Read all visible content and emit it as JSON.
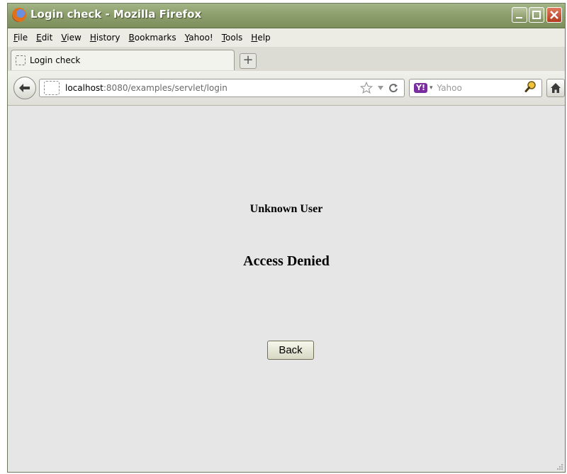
{
  "window": {
    "title": "Login check - Mozilla Firefox"
  },
  "menu": {
    "items": [
      "File",
      "Edit",
      "View",
      "History",
      "Bookmarks",
      "Yahoo!",
      "Tools",
      "Help"
    ]
  },
  "tabs": [
    {
      "label": "Login check",
      "active": true
    }
  ],
  "navbar": {
    "url_host": "localhost",
    "url_rest": ":8080/examples/servlet/login",
    "search_engine_badge": "Y!",
    "search_placeholder": "Yahoo"
  },
  "page": {
    "message_user": "Unknown User",
    "message_status": "Access Denied",
    "back_button_label": "Back"
  },
  "colors": {
    "titlebar": "#8d9f6c",
    "content_bg": "#e6e6e6",
    "close_button": "#b33b1e"
  },
  "icons": {
    "app": "firefox-logo-icon",
    "back": "back-arrow-icon",
    "bookmark": "star-icon",
    "reload": "reload-icon",
    "search": "search-icon",
    "home": "home-icon"
  }
}
